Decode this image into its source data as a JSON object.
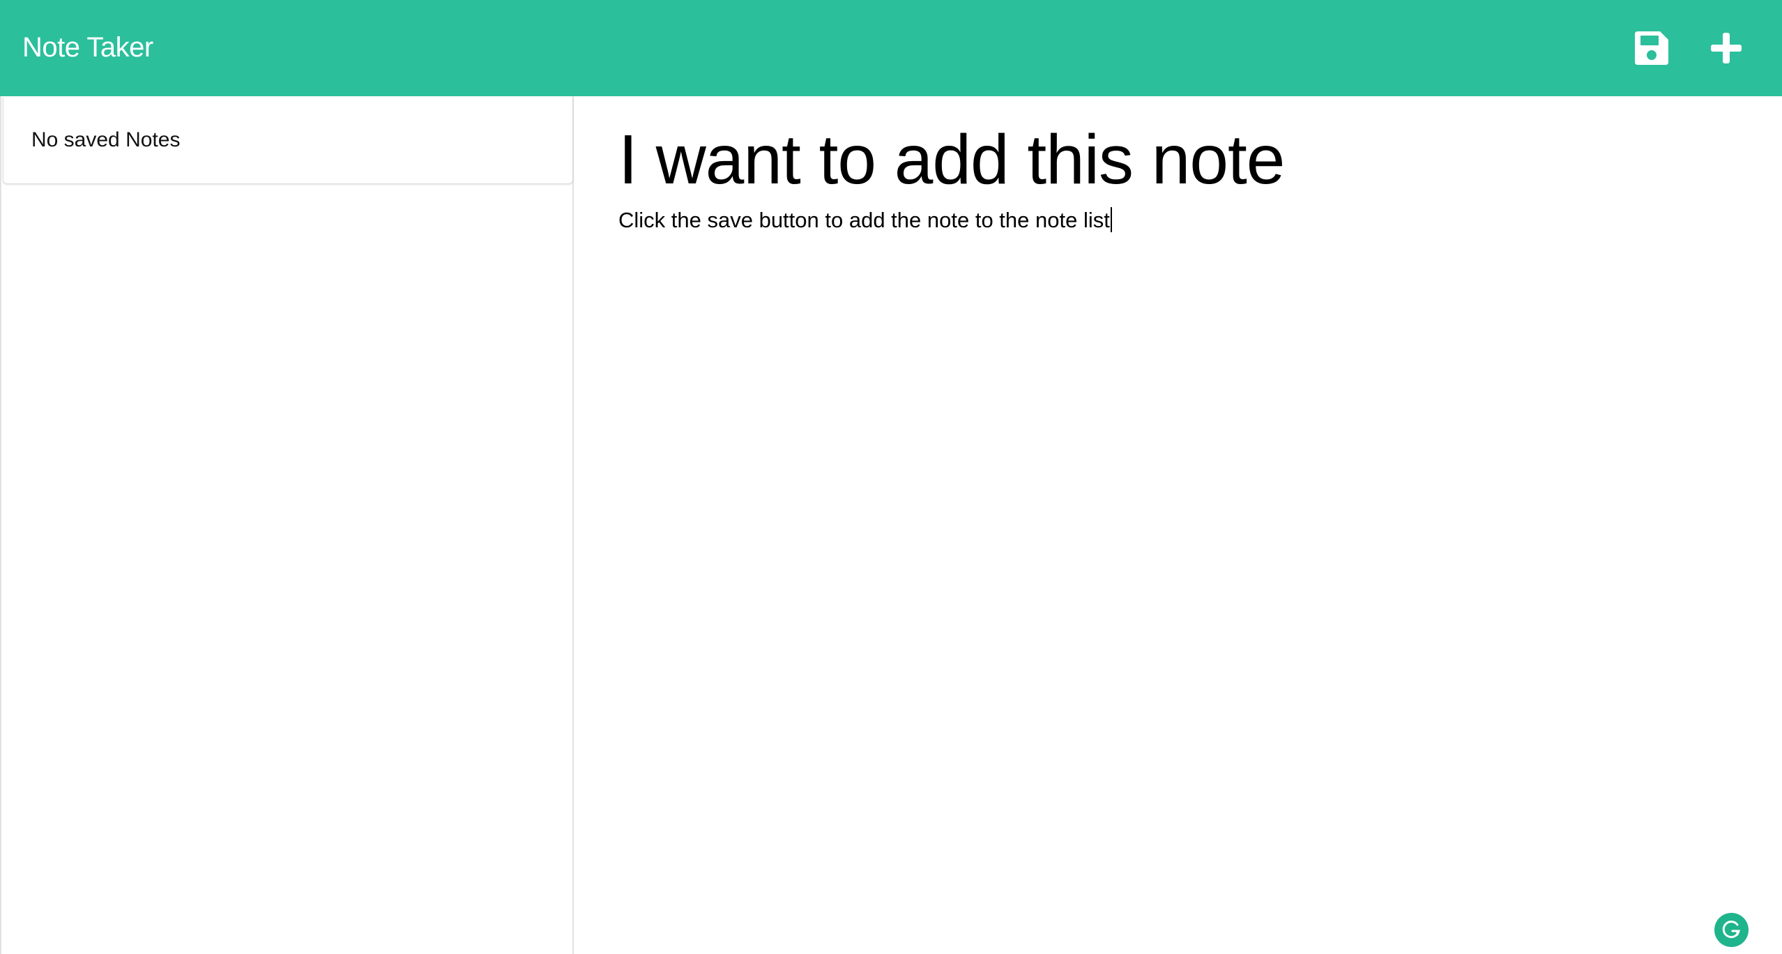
{
  "navbar": {
    "brand": "Note Taker",
    "save_icon": "floppy-disk-icon",
    "new_icon": "plus-icon",
    "accent_color": "#2bbf9c"
  },
  "sidebar": {
    "items": [
      {
        "label": "No saved Notes"
      }
    ]
  },
  "editor": {
    "title": "I want to add this note",
    "text": "Click the save button to add the note to the note list"
  },
  "extension": {
    "icon": "grammarly-icon",
    "color": "#1fb48c"
  }
}
